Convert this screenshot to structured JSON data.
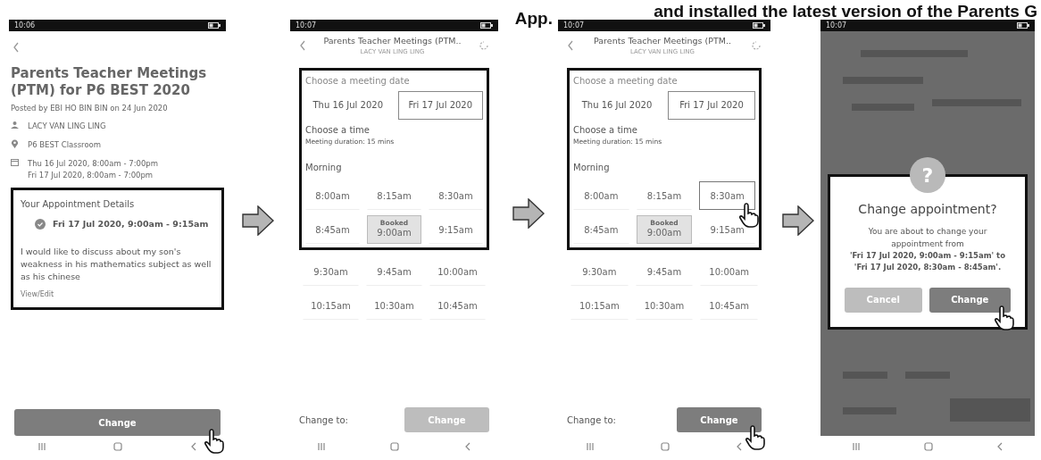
{
  "heading": {
    "text": "and installed the latest version of the Parents G",
    "tail": "App."
  },
  "phones": [
    {
      "kind": "details",
      "status_time": "10:06",
      "title": "Parents Teacher Meetings (PTM) for P6 BEST 2020",
      "posted": "Posted by EBI HO BIN BIN on 24 Jun 2020",
      "teacher": "LACY VAN LING LING",
      "venue": "P6 BEST Classroom",
      "dates": [
        "Thu 16 Jul 2020, 8:00am - 7:00pm",
        "Fri 17 Jul 2020, 8:00am - 7:00pm"
      ],
      "appointment": {
        "framed": true,
        "heading": "Your Appointment Details",
        "slot": "Fri 17 Jul 2020, 9:00am - 9:15am",
        "note": "I would like to discuss about my son's weakness in his mathematics subject as well as his chinese",
        "link": "View/Edit"
      },
      "button": {
        "label": "Change",
        "enabled": true,
        "tapped": true
      }
    },
    {
      "kind": "picker",
      "status_time": "10:07",
      "header": "Parents Teacher Meetings (PTM..",
      "subheader": "LACY VAN LING LING",
      "date_heading": "Choose a meeting date",
      "dates": [
        {
          "label": "Thu 16 Jul 2020",
          "selected": false
        },
        {
          "label": "Fri 17 Jul 2020",
          "selected": true
        }
      ],
      "time_heading": "Choose a time",
      "duration": "Meeting duration: 15 mins",
      "period": "Morning",
      "framed_slots": [
        {
          "time": "8:00am",
          "selected": false,
          "booked": false,
          "tapped": false
        },
        {
          "time": "8:15am",
          "selected": false,
          "booked": false,
          "tapped": false
        },
        {
          "time": "8:30am",
          "selected": false,
          "booked": false,
          "tapped": false
        },
        {
          "time": "8:45am",
          "selected": false,
          "booked": false,
          "tapped": false
        },
        {
          "time": "9:00am",
          "booked_label": "Booked",
          "selected": false,
          "booked": true,
          "tapped": false
        },
        {
          "time": "9:15am",
          "selected": false,
          "booked": false,
          "tapped": false
        }
      ],
      "other_slots": [
        {
          "time": "9:30am",
          "selected": false,
          "booked": false,
          "tapped": false
        },
        {
          "time": "9:45am",
          "selected": false,
          "booked": false,
          "tapped": false
        },
        {
          "time": "10:00am",
          "selected": false,
          "booked": false,
          "tapped": false
        },
        {
          "time": "10:15am",
          "selected": false,
          "booked": false,
          "tapped": false
        },
        {
          "time": "10:30am",
          "selected": false,
          "booked": false,
          "tapped": false
        },
        {
          "time": "10:45am",
          "selected": false,
          "booked": false,
          "tapped": false
        }
      ],
      "change_label": "Change to:",
      "button": {
        "label": "Change",
        "enabled": false,
        "tapped": false
      }
    },
    {
      "kind": "picker",
      "status_time": "10:07",
      "header": "Parents Teacher Meetings (PTM..",
      "subheader": "LACY VAN LING LING",
      "date_heading": "Choose a meeting date",
      "dates": [
        {
          "label": "Thu 16 Jul 2020",
          "selected": false
        },
        {
          "label": "Fri 17 Jul 2020",
          "selected": true
        }
      ],
      "time_heading": "Choose a time",
      "duration": "Meeting duration: 15 mins",
      "period": "Morning",
      "framed_slots": [
        {
          "time": "8:00am",
          "selected": false,
          "booked": false,
          "tapped": false
        },
        {
          "time": "8:15am",
          "selected": false,
          "booked": false,
          "tapped": false
        },
        {
          "time": "8:30am",
          "selected": true,
          "booked": false,
          "tapped": true
        },
        {
          "time": "8:45am",
          "selected": false,
          "booked": false,
          "tapped": false
        },
        {
          "time": "9:00am",
          "booked_label": "Booked",
          "selected": false,
          "booked": true,
          "tapped": false
        },
        {
          "time": "9:15am",
          "selected": false,
          "booked": false,
          "tapped": false
        }
      ],
      "other_slots": [
        {
          "time": "9:30am",
          "selected": false,
          "booked": false,
          "tapped": false
        },
        {
          "time": "9:45am",
          "selected": false,
          "booked": false,
          "tapped": false
        },
        {
          "time": "10:00am",
          "selected": false,
          "booked": false,
          "tapped": false
        },
        {
          "time": "10:15am",
          "selected": false,
          "booked": false,
          "tapped": false
        },
        {
          "time": "10:30am",
          "selected": false,
          "booked": false,
          "tapped": false
        },
        {
          "time": "10:45am",
          "selected": false,
          "booked": false,
          "tapped": false
        }
      ],
      "change_label": "Change to:",
      "button": {
        "label": "Change",
        "enabled": true,
        "tapped": true
      }
    },
    {
      "kind": "dialog",
      "status_time": "10:07",
      "dialog": {
        "framed": true,
        "icon": "?",
        "title": "Change appointment?",
        "message": "You are about to change your appointment from",
        "from": "'Fri 17 Jul 2020, 9:00am - 9:15am' to",
        "to": "'Fri 17 Jul 2020, 8:30am - 8:45am'.",
        "buttons": [
          {
            "label": "Cancel",
            "kind": "secondary",
            "tapped": false
          },
          {
            "label": "Change",
            "kind": "primary",
            "tapped": true
          }
        ]
      }
    }
  ]
}
